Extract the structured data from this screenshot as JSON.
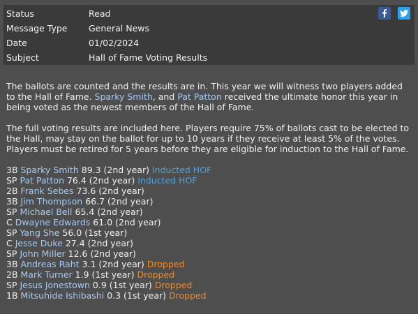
{
  "header": {
    "rows": [
      {
        "label": "Status",
        "value": "Read"
      },
      {
        "label": "Message Type",
        "value": "General News"
      },
      {
        "label": "Date",
        "value": "01/02/2024"
      },
      {
        "label": "Subject",
        "value": "Hall of Fame Voting Results"
      }
    ],
    "social": {
      "facebook_icon": "f",
      "twitter_icon": "bird"
    }
  },
  "body": {
    "p1_a": "The ballots are counted and the results are in. This year we will witness two players added to the Hall of Fame. ",
    "p1_link1": "Sparky Smith",
    "p1_b": ", and ",
    "p1_link2": "Pat Patton",
    "p1_c": " received the ultimate honor this year in being voted as the newest members of the Hall of Fame.",
    "p2": "The full voting results are included here. Players require 75% of ballots cast to be elected to the Hall, may stay on the ballot for up to 10 years if they receive at least 5% of the votes. Players must be retired for 5 years before they are eligible for induction to the Hall of Fame."
  },
  "results": [
    {
      "pos": "3B",
      "name": "Sparky Smith",
      "stats": "89.3 (2nd year)",
      "note": "Inducted HOF",
      "note_type": "inducted"
    },
    {
      "pos": "SP",
      "name": "Pat Patton",
      "stats": "76.4 (2nd year)",
      "note": "Inducted HOF",
      "note_type": "inducted"
    },
    {
      "pos": "2B",
      "name": "Frank Sebes",
      "stats": "73.6 (2nd year)",
      "note": "",
      "note_type": ""
    },
    {
      "pos": "3B",
      "name": "Jim Thompson",
      "stats": "66.7 (2nd year)",
      "note": "",
      "note_type": ""
    },
    {
      "pos": "SP",
      "name": "Michael Bell",
      "stats": "65.4 (2nd year)",
      "note": "",
      "note_type": ""
    },
    {
      "pos": "C",
      "name": "Dwayne Edwards",
      "stats": "61.0 (2nd year)",
      "note": "",
      "note_type": ""
    },
    {
      "pos": "SP",
      "name": "Yang She",
      "stats": "56.0 (1st year)",
      "note": "",
      "note_type": ""
    },
    {
      "pos": "C",
      "name": "Jesse Duke",
      "stats": "27.4 (2nd year)",
      "note": "",
      "note_type": ""
    },
    {
      "pos": "SP",
      "name": "John Miller",
      "stats": "12.6 (2nd year)",
      "note": "",
      "note_type": ""
    },
    {
      "pos": "3B",
      "name": "Andreas Raht",
      "stats": "3.1 (2nd year)",
      "note": "Dropped",
      "note_type": "dropped"
    },
    {
      "pos": "2B",
      "name": "Mark Turner",
      "stats": "1.9 (1st year)",
      "note": "Dropped",
      "note_type": "dropped"
    },
    {
      "pos": "SP",
      "name": "Jesus Jonestown",
      "stats": "0.9 (1st year)",
      "note": "Dropped",
      "note_type": "dropped"
    },
    {
      "pos": "1B",
      "name": "Mitsuhide Ishibashi",
      "stats": "0.3 (1st year)",
      "note": "Dropped",
      "note_type": "dropped"
    }
  ],
  "colors": {
    "background": "#4e4e4e",
    "header_bg": "#3a3a3a",
    "link": "#a7c9f0",
    "inducted": "#4ea3da",
    "dropped": "#f08a28",
    "facebook": "#3a5a98",
    "twitter": "#2aa3ef"
  }
}
